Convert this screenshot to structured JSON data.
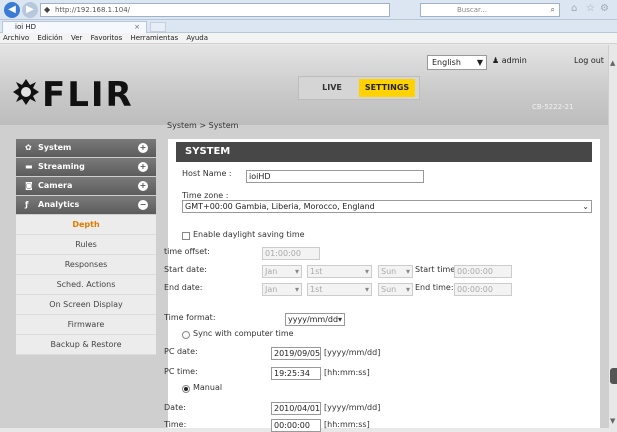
{
  "browser": {
    "url": "http://192.168.1.104/",
    "search_placeholder": "Buscar...",
    "tab_title": "ioi HD",
    "menu": [
      "Archivo",
      "Edición",
      "Ver",
      "Favoritos",
      "Herramientas",
      "Ayuda"
    ]
  },
  "header": {
    "logo_text": "FLIR",
    "language": "English",
    "user": "admin",
    "logout": "Log out",
    "mode_live": "LIVE",
    "mode_settings": "SETTINGS",
    "device_id": "CB-5222-21",
    "accent_color": "#ffd200"
  },
  "breadcrumb": "System > System",
  "sidebar": {
    "sections": [
      {
        "label": "System",
        "icon": "gear-icon",
        "toggle": "+"
      },
      {
        "label": "Streaming",
        "icon": "monitor-icon",
        "toggle": "+"
      },
      {
        "label": "Camera",
        "icon": "camera-icon",
        "toggle": "+"
      },
      {
        "label": "Analytics",
        "icon": "analytics-icon",
        "toggle": "−"
      }
    ],
    "subitems": [
      "Depth",
      "Rules",
      "Responses",
      "Sched. Actions",
      "On Screen Display",
      "Firmware",
      "Backup & Restore"
    ],
    "active_color": "#e27b00"
  },
  "system": {
    "title": "SYSTEM",
    "host_name_label": "Host Name :",
    "host_name": "ioiHD",
    "timezone_label": "Time zone :",
    "timezone": "GMT+00:00 Gambia, Liberia, Morocco, England",
    "dst_label": "Enable daylight saving time",
    "time_offset_label": "time offset:",
    "time_offset": "01:00:00",
    "start_date_label": "Start date:",
    "end_date_label": "End date:",
    "month": "Jan",
    "day": "1st",
    "weekday": "Sun",
    "start_time_label": "Start time:",
    "end_time_label": "End time:",
    "start_time": "00:00:00",
    "end_time": "00:00:00",
    "time_format_label": "Time format:",
    "time_format": "yyyy/mm/dd",
    "sync_label": "Sync with computer time",
    "pc_date_label": "PC date:",
    "pc_date": "2019/09/05",
    "pc_date_hint": "[yyyy/mm/dd]",
    "pc_time_label": "PC time:",
    "pc_time": "19:25:34",
    "pc_time_hint": "[hh:mm:ss]",
    "manual_label": "Manual",
    "date_label": "Date:",
    "date": "2010/04/01",
    "date_hint": "[yyyy/mm/dd]",
    "time_label": "Time:",
    "time": "00:00:00",
    "time_hint": "[hh:mm:ss]"
  }
}
